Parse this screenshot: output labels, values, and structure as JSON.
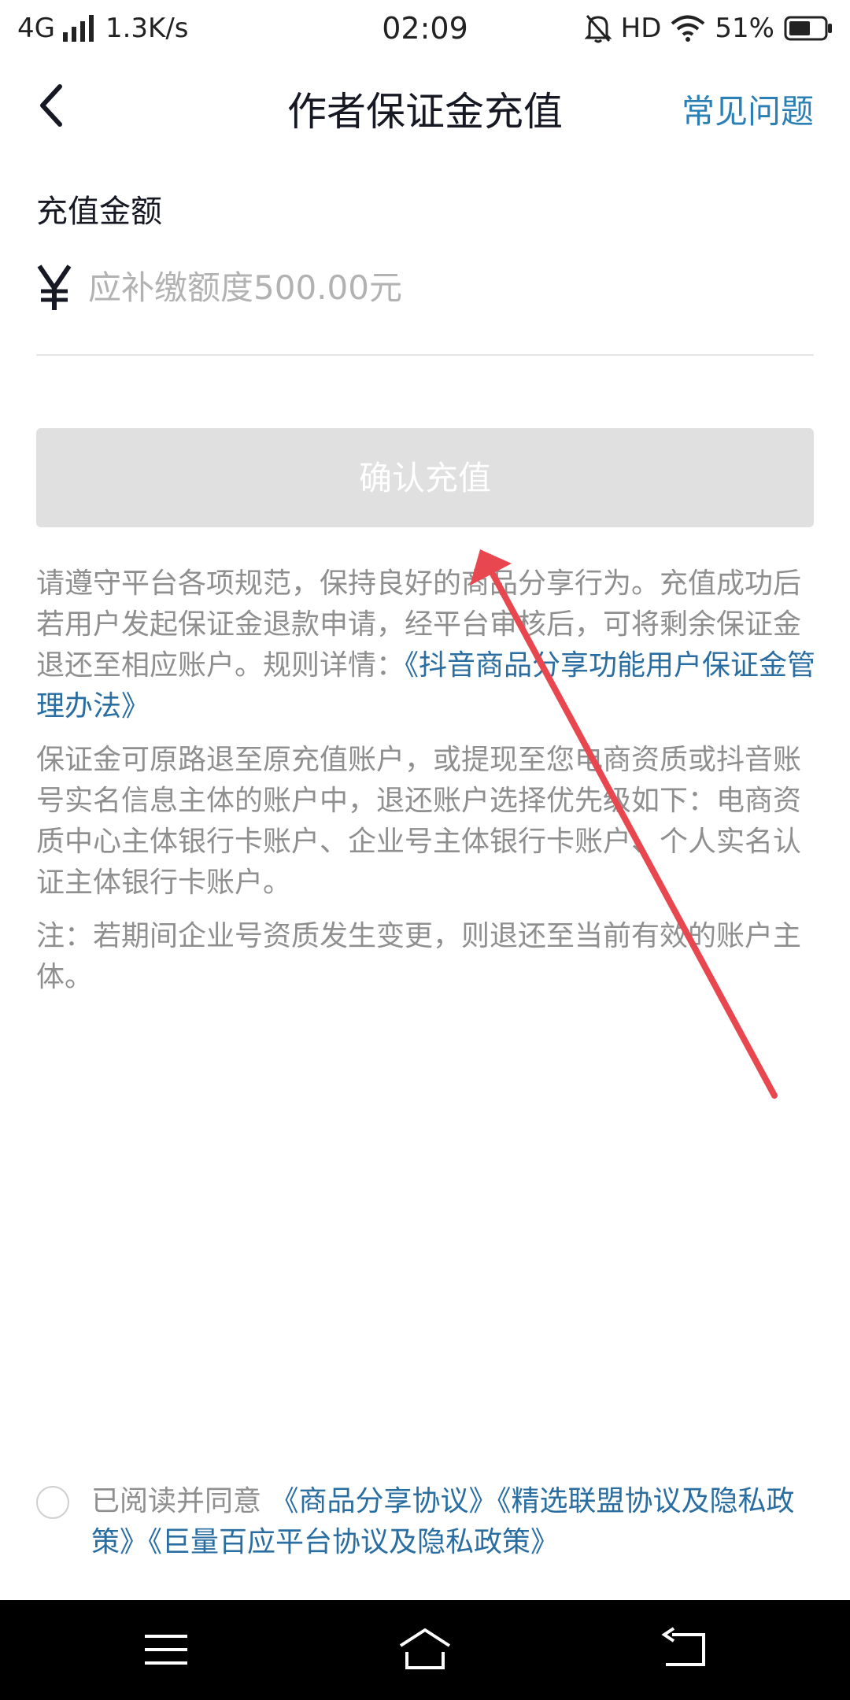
{
  "status_bar": {
    "network": "4G",
    "speed": "1.3K/s",
    "time": "02:09",
    "hd": "HD",
    "battery": "51%"
  },
  "header": {
    "title": "作者保证金充值",
    "faq_label": "常见问题"
  },
  "form": {
    "amount_label": "充值金额",
    "currency_symbol": "¥",
    "amount_placeholder": "应补缴额度500.00元",
    "confirm_label": "确认充值"
  },
  "notes": {
    "p1_text": "请遵守平台各项规范，保持良好的商品分享行为。充值成功后若用户发起保证金退款申请，经平台审核后，可将剩余保证金退还至相应账户。规则详情：",
    "p1_link": "《抖音商品分享功能用户保证金管理办法》",
    "p2_text": "保证金可原路退至原充值账户，或提现至您电商资质或抖音账号实名信息主体的账户中，退还账户选择优先级如下：电商资质中心主体银行卡账户、企业号主体银行卡账户、个人实名认证主体银行卡账户。",
    "p3_text": "注：若期间企业号资质发生变更，则退还至当前有效的账户主体。"
  },
  "agreement": {
    "prefix": "已阅读并同意",
    "link1": "《商品分享协议》",
    "link2": "《精选联盟协议及隐私政策》",
    "link3": "《巨量百应平台协议及隐私政策》"
  },
  "colors": {
    "link": "#2a6ea1",
    "faq": "#2a7fb5",
    "button_disabled": "#e0e0e0",
    "annotation_arrow": "#e8474f"
  },
  "icons": [
    "back-arrow-icon",
    "signal-icon",
    "mute-bell-icon",
    "wifi-icon",
    "battery-icon",
    "menu-icon",
    "home-icon",
    "return-icon"
  ]
}
